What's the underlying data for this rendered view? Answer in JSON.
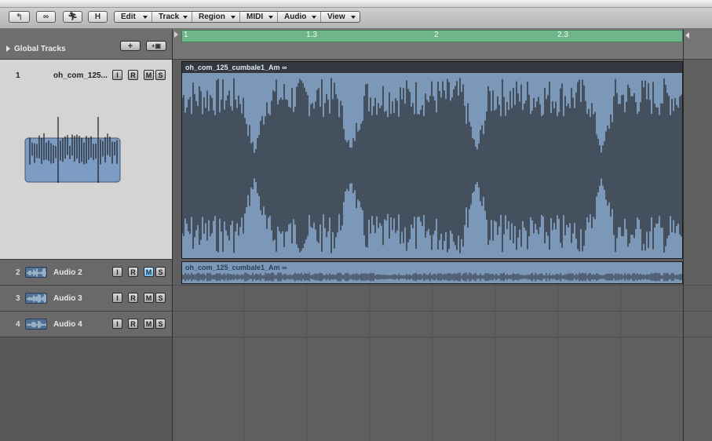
{
  "toolbar": {
    "h_label": "H",
    "menus": [
      {
        "label": "Edit"
      },
      {
        "label": "Track"
      },
      {
        "label": "Region"
      },
      {
        "label": "MIDI"
      },
      {
        "label": "Audio"
      },
      {
        "label": "View"
      }
    ]
  },
  "global_tracks": {
    "label": "Global Tracks",
    "add_label": "+"
  },
  "ruler": {
    "markers": [
      "1",
      "1.3",
      "2",
      "2.3"
    ]
  },
  "tracks": [
    {
      "number": "1",
      "name": "oh_com_125...",
      "i": "I",
      "r": "R",
      "m": "M",
      "s": "S",
      "mute_on": false
    },
    {
      "number": "2",
      "name": "Audio 2",
      "i": "I",
      "r": "R",
      "m": "M",
      "s": "S",
      "mute_on": true
    },
    {
      "number": "3",
      "name": "Audio 3",
      "i": "I",
      "r": "R",
      "m": "M",
      "s": "S",
      "mute_on": false
    },
    {
      "number": "4",
      "name": "Audio 4",
      "i": "I",
      "r": "R",
      "m": "M",
      "s": "S",
      "mute_on": false
    }
  ],
  "regions": [
    {
      "name": "oh_com_125_cumbale1_Am"
    },
    {
      "name": "oh_com_125_cumbale1_Am"
    }
  ],
  "colors": {
    "cycle": "#6fb58a",
    "region": "#7c98b8",
    "waveform": "#44505e",
    "mute_active": "#6fb5e6"
  }
}
